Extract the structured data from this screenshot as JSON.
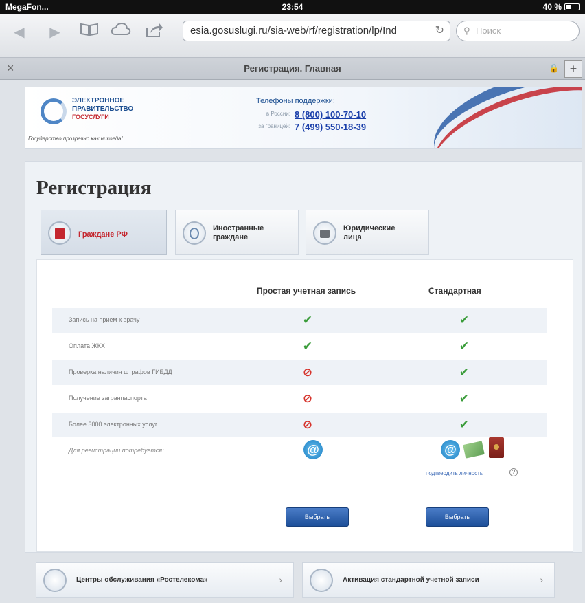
{
  "statusbar": {
    "carrier": "MegaFon...",
    "time": "23:54",
    "battery": "40 %"
  },
  "browser": {
    "url": "esia.gosuslugi.ru/sia-web/rf/registration/lp/Ind",
    "search_placeholder": "Поиск",
    "tab_title": "Регистрация. Главная"
  },
  "header": {
    "logo_line1": "ЭЛЕКТРОННОЕ",
    "logo_line2": "ПРАВИТЕЛЬСТВО",
    "logo_line3": "ГОСУСЛУГИ",
    "slogan": "Государство прозрачно как никогда!",
    "support_title": "Телефоны поддержки:",
    "support_russia_label": "в России:",
    "support_abroad_label": "за границей:",
    "phone_russia": "8 (800) 100-70-10",
    "phone_abroad": "7 (499) 550-18-39"
  },
  "page": {
    "title": "Регистрация",
    "tabs": [
      {
        "label": "Граждане РФ",
        "active": true
      },
      {
        "label_line1": "Иностранные",
        "label_line2": "граждане",
        "active": false
      },
      {
        "label_line1": "Юридические",
        "label_line2": "лица",
        "active": false
      }
    ]
  },
  "comparison": {
    "col_simple": "Простая учетная запись",
    "col_standard": "Стандартная",
    "rows": [
      {
        "label": "Запись на прием к врачу",
        "simple": "yes",
        "standard": "yes"
      },
      {
        "label": "Оплата ЖКХ",
        "simple": "yes",
        "standard": "yes"
      },
      {
        "label": "Проверка наличия штрафов ГИБДД",
        "simple": "no",
        "standard": "yes"
      },
      {
        "label": "Получение загранпаспорта",
        "simple": "no",
        "standard": "yes"
      },
      {
        "label": "Более 3000 электронных услуг",
        "simple": "no",
        "standard": "yes"
      }
    ],
    "required_label": "Для регистрации потребуется:",
    "verify_link": "подтвердить личность",
    "choose_simple": "Выбрать",
    "choose_standard": "Выбрать"
  },
  "services": {
    "centers": "Центры обслуживания «Ростелекома»",
    "activation": "Активация стандартной учетной записи"
  },
  "colors": {
    "accent_red": "#c4262e",
    "brand_blue": "#1d4f91",
    "check_green": "#3a9c3a",
    "cross_red": "#d6342c"
  }
}
